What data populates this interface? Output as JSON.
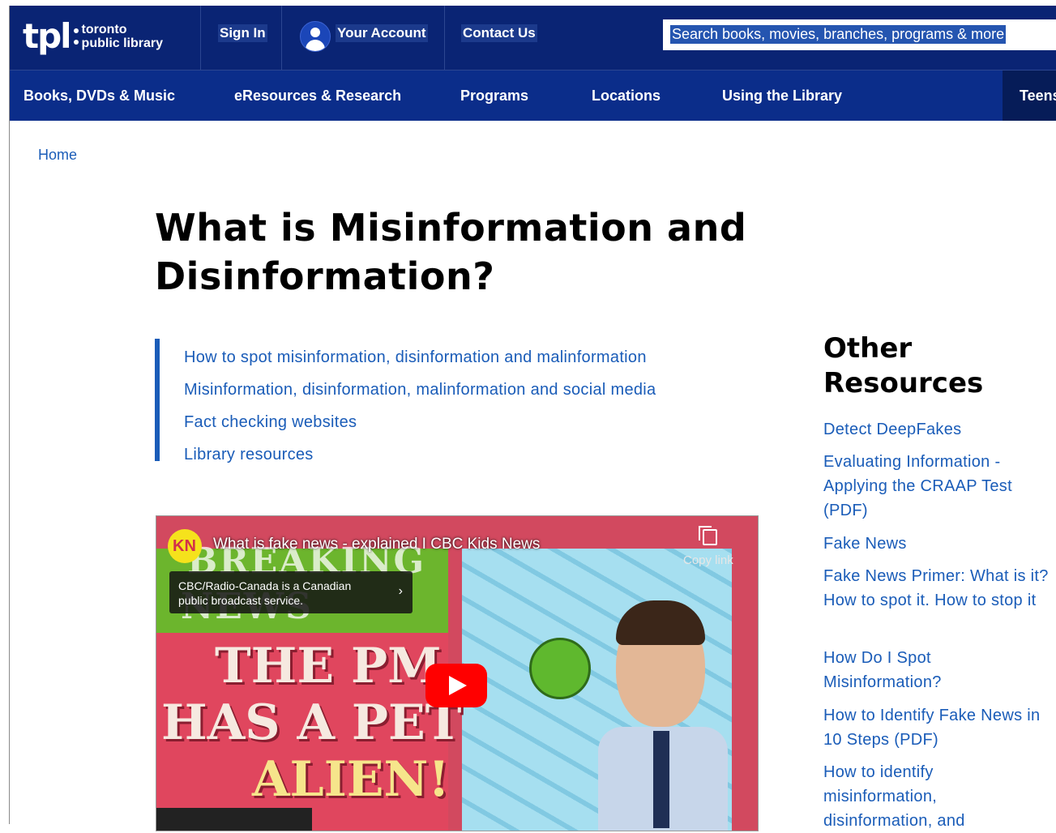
{
  "header": {
    "logo_mark": "tpl",
    "logo_line1": "toronto",
    "logo_line2": "public library",
    "sign_in": "Sign In",
    "your_account": "Your Account",
    "contact_us": "Contact Us",
    "search_placeholder": "Search books, movies, branches, programs & more"
  },
  "nav": {
    "items": [
      "Books, DVDs & Music",
      "eResources & Research",
      "Programs",
      "Locations",
      "Using the Library",
      "Teens"
    ]
  },
  "breadcrumb": {
    "home": "Home"
  },
  "page": {
    "title": "What is Misinformation and Disinformation?",
    "toc": [
      "How to spot misinformation, disinformation and malinformation",
      "Misinformation, disinformation, malinformation and social media",
      "Fact checking websites",
      "Library resources"
    ]
  },
  "video": {
    "title": "What is fake news - explained I CBC Kids News",
    "badge": "KN",
    "copy_link": "Copy link",
    "info_text": "CBC/Radio-Canada is a Canadian public broadcast service.",
    "breaking": "BREAKING",
    "news": "NEWS",
    "line1": "THE PM",
    "line2": "HAS A PET",
    "line3": "ALIEN!"
  },
  "sidebar": {
    "title": "Other Resources",
    "links": [
      "Detect DeepFakes",
      "Evaluating Information - Applying the CRAAP Test (PDF)",
      "Fake News",
      "Fake News Primer: What is it? How to spot it. How to stop it",
      "How Do I Spot Misinformation?",
      "How to Identify Fake News in 10 Steps (PDF)",
      "How to identify misinformation, disinformation, and"
    ]
  }
}
